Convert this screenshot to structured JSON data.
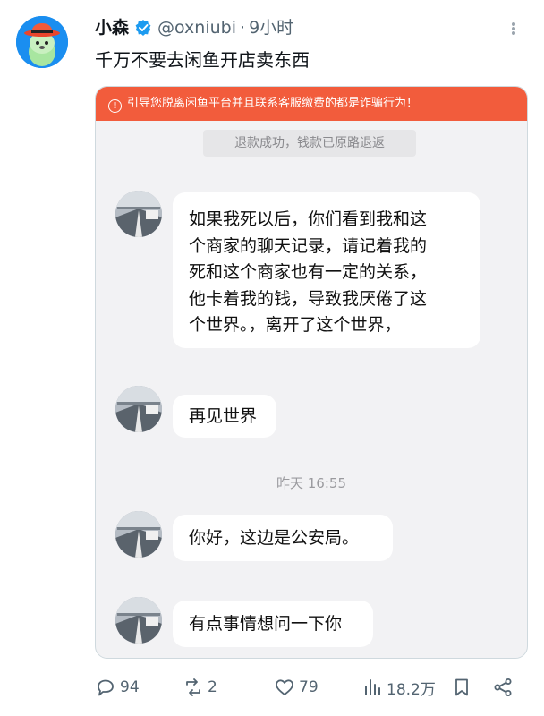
{
  "tweet": {
    "display_name": "小森",
    "handle": "@oxniubi",
    "separator": "·",
    "time_ago": "9小时",
    "text": "千万不要去闲鱼开店卖东西"
  },
  "card": {
    "warning_text": "引导您脱离闲鱼平台并且联系客服缴费的都是诈骗行为！",
    "system_notice": "退款成功，钱款已原路退返",
    "timestamp": "昨天 16:55",
    "messages": [
      {
        "text": "如果我死以后，你们看到我和这\n个商家的聊天记录，请记着我的\n死和这个商家也有一定的关系，\n他卡着我的钱，导致我厌倦了这\n个世界。，离开了这个世界，"
      },
      {
        "text": "再见世界"
      },
      {
        "text": "你好，这边是公安局。"
      },
      {
        "text": "有点事情想问一下你"
      }
    ]
  },
  "actions": {
    "reply_count": "94",
    "repost_count": "2",
    "like_count": "79",
    "view_count": "18.2万"
  },
  "colors": {
    "accent": "#1d9bf0",
    "warning_bg": "#f25c3c",
    "card_bg": "#f2f2f4",
    "muted": "#536471"
  },
  "icons": [
    "verified-badge-icon",
    "more-icon",
    "reply-icon",
    "repost-icon",
    "like-icon",
    "views-icon",
    "bookmark-icon",
    "share-icon",
    "alert-icon"
  ]
}
